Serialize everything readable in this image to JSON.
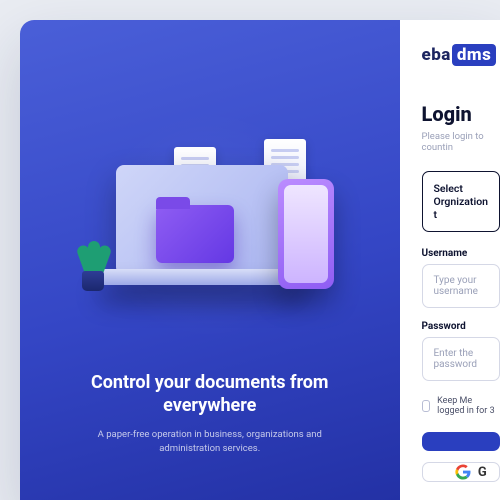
{
  "brand": {
    "part1": "eba",
    "part2": "dms"
  },
  "hero": {
    "title": "Control your documents from everywhere",
    "subtitle": "A paper-free operation in business, organizations and administration services."
  },
  "login": {
    "title": "Login",
    "subtitle": "Please login to countin",
    "org_select_label": "Select Orgnization t",
    "username_label": "Username",
    "username_placeholder": "Type your username",
    "password_label": "Password",
    "password_placeholder": "Enter the password",
    "remember_label": "Keep Me logged in for 3",
    "google_prefix": "G"
  },
  "colors": {
    "primary": "#2a3fbf"
  }
}
